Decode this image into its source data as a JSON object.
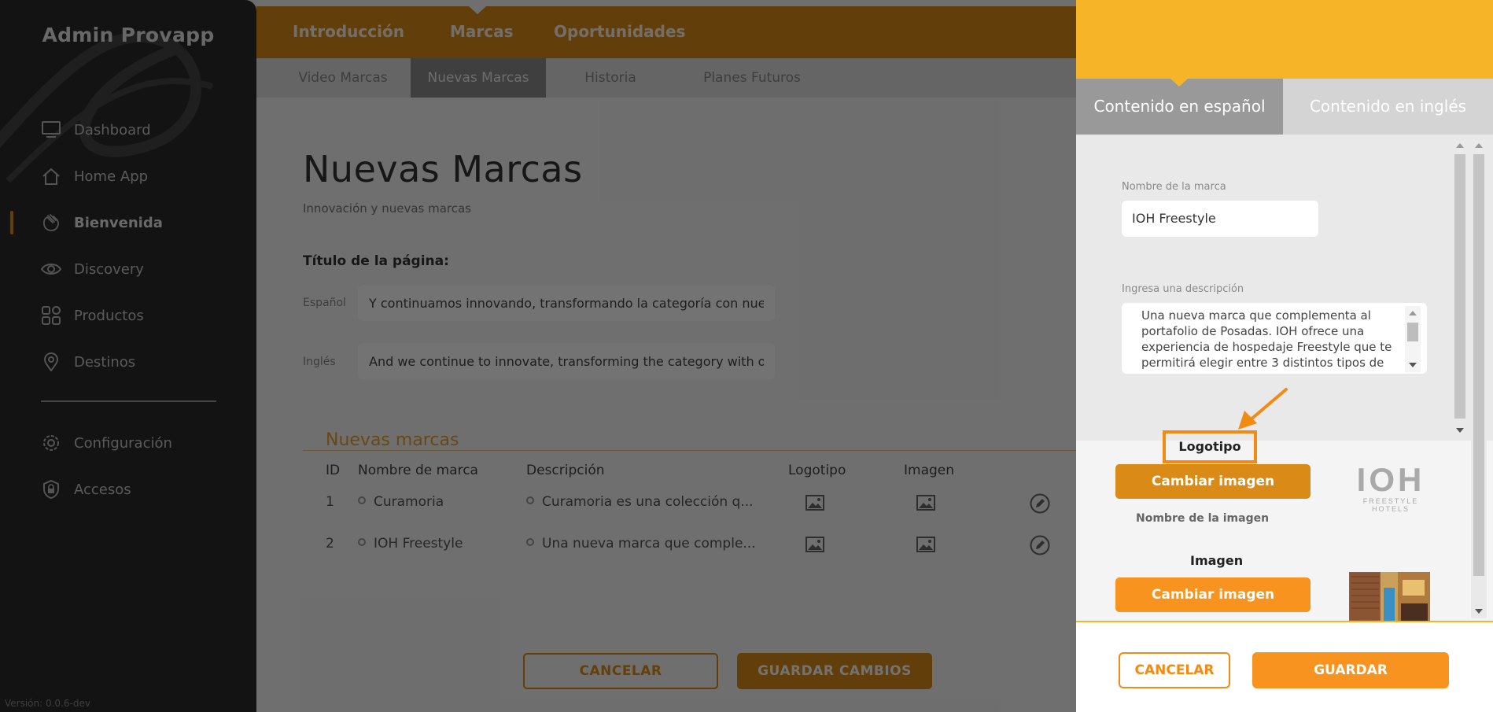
{
  "sidebar": {
    "brand": "Admin Provapp",
    "items": [
      {
        "label": "Dashboard",
        "icon": "monitor-icon"
      },
      {
        "label": "Home App",
        "icon": "home-icon"
      },
      {
        "label": "Bienvenida",
        "icon": "wave-hand-icon",
        "active": true
      },
      {
        "label": "Discovery",
        "icon": "eye-icon"
      },
      {
        "label": "Productos",
        "icon": "grid-icon"
      },
      {
        "label": "Destinos",
        "icon": "map-pin-icon"
      }
    ],
    "bottom_items": [
      {
        "label": "Configuración",
        "icon": "gear-icon"
      },
      {
        "label": "Accesos",
        "icon": "shield-lock-icon"
      }
    ],
    "version": "Versión: 0.0.6-dev",
    "accent": "#e08c10"
  },
  "topnav": {
    "tabs": [
      {
        "label": "Introducción"
      },
      {
        "label": "Marcas",
        "active": true
      },
      {
        "label": "Oportunidades"
      }
    ]
  },
  "subnav": {
    "tabs": [
      {
        "label": "Video Marcas"
      },
      {
        "label": "Nuevas Marcas",
        "active": true
      },
      {
        "label": "Historia"
      },
      {
        "label": "Planes Futuros"
      }
    ]
  },
  "page": {
    "title": "Nuevas Marcas",
    "subtitle": "Innovación y nuevas marcas",
    "section_label": "Título de la página:",
    "lang_es_label": "Español",
    "lang_en_label": "Inglés",
    "title_es_value": "Y continuamos innovando, transformando la categoría con nuestras n",
    "title_en_value": "And we continue to innovate, transforming the category with our new"
  },
  "table": {
    "title": "Nuevas marcas",
    "headers": [
      "ID",
      "Nombre de marca",
      "Descripción",
      "Logotipo",
      "Imagen"
    ],
    "rows": [
      {
        "id": "1",
        "name": "Curamoria",
        "description": "Curamoria es una colección q..."
      },
      {
        "id": "2",
        "name": "IOH Freestyle",
        "description": "Una nueva marca que comple..."
      }
    ]
  },
  "actions": {
    "cancel": "CANCELAR",
    "save": "GUARDAR CAMBIOS"
  },
  "drawer": {
    "tabs": [
      {
        "label": "Contenido en español",
        "active": true
      },
      {
        "label": "Contenido en inglés"
      }
    ],
    "brand_name_label": "Nombre de la marca",
    "brand_name_value": "IOH Freestyle",
    "description_label": "Ingresa una descripción",
    "description_value": "Una nueva marca que complementa al portafolio de Posadas. IOH ofrece una experiencia de hospedaje Freestyle que te permitirá elegir entre 3 distintos tipos de",
    "logo_label": "Logotipo",
    "change_image_label": "Cambiar imagen",
    "image_name_label": "Nombre de la imagen",
    "image_label": "Imagen",
    "logo_preview_text": "IOH",
    "logo_preview_subtext": "FREESTYLE HOTELS",
    "cancel": "CANCELAR",
    "save": "GUARDAR",
    "accent": "#f7931e",
    "header_color": "#f6b529"
  }
}
